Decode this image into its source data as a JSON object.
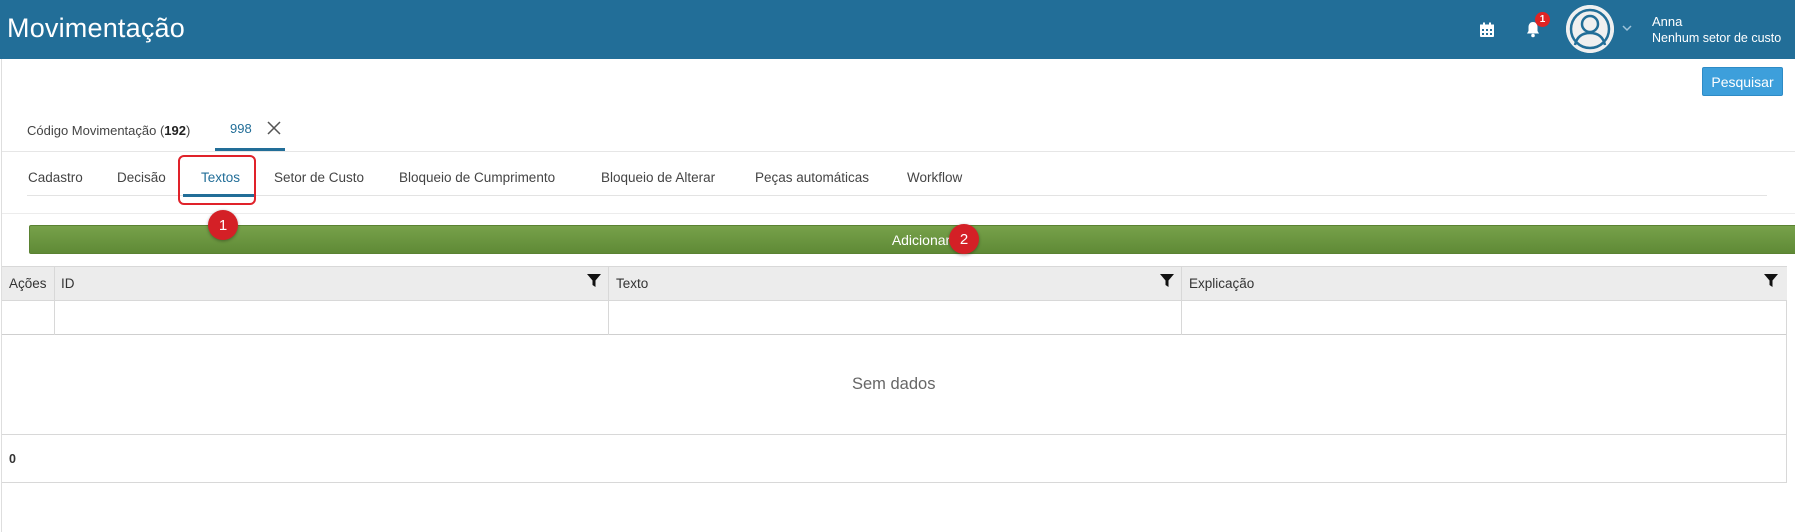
{
  "header": {
    "title": "Movimentação",
    "notification_count": "1",
    "user_name": "Anna",
    "user_sector": "Nenhum setor de custo",
    "icons": [
      "calendar-icon",
      "bell-icon",
      "user-avatar-icon",
      "chevron-down-icon"
    ],
    "background_color": "#226e98"
  },
  "toolbar": {
    "search_label": "Pesquisar"
  },
  "record_tabs": {
    "label_prefix": "Código Movimentação (",
    "label_count": "192",
    "label_suffix": ")",
    "active_record": "998"
  },
  "sub_tabs": [
    {
      "label": "Cadastro"
    },
    {
      "label": "Decisão"
    },
    {
      "label": "Textos",
      "active": true
    },
    {
      "label": "Setor de Custo"
    },
    {
      "label": "Bloqueio de Cumprimento"
    },
    {
      "label": "Bloqueio de Alterar"
    },
    {
      "label": "Peças automáticas"
    },
    {
      "label": "Workflow"
    }
  ],
  "annotations": {
    "step1": "1",
    "step2": "2",
    "color": "#d42026"
  },
  "actions": {
    "add_label": "Adicionar",
    "add_color": "#6b9540"
  },
  "grid": {
    "columns": [
      {
        "label": "Ações"
      },
      {
        "label": "ID"
      },
      {
        "label": "Texto"
      },
      {
        "label": "Explicação"
      }
    ],
    "empty_text": "Sem dados",
    "total": "0"
  }
}
